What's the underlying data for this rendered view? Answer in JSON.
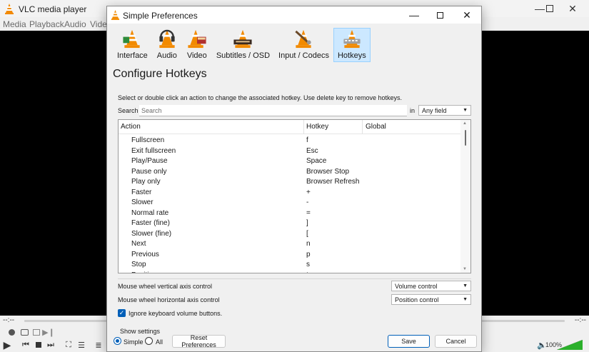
{
  "vlc": {
    "title": "VLC media player",
    "menu": [
      "Media",
      "Playback",
      "Audio",
      "Video"
    ],
    "time_elapsed": "--:--",
    "time_total": "--:--",
    "volume": "100%",
    "volume_level": 1.0
  },
  "dialog": {
    "title": "Simple Preferences",
    "categories": [
      {
        "label": "Interface",
        "icon": "interface-icon"
      },
      {
        "label": "Audio",
        "icon": "audio-icon"
      },
      {
        "label": "Video",
        "icon": "video-icon"
      },
      {
        "label": "Subtitles / OSD",
        "icon": "subtitles-icon"
      },
      {
        "label": "Input / Codecs",
        "icon": "input-codecs-icon"
      },
      {
        "label": "Hotkeys",
        "icon": "hotkeys-icon",
        "active": true
      }
    ],
    "section_title": "Configure Hotkeys",
    "instructions": "Select or double click an action to change the associated hotkey. Use delete key to remove hotkeys.",
    "search": {
      "label": "Search",
      "placeholder": "Search",
      "in_label": "in",
      "field_value": "Any field"
    },
    "table": {
      "headers": [
        "Action",
        "Hotkey",
        "Global"
      ],
      "rows": [
        {
          "action": "Fullscreen",
          "hotkey": "f"
        },
        {
          "action": "Exit fullscreen",
          "hotkey": "Esc"
        },
        {
          "action": "Play/Pause",
          "hotkey": "Space"
        },
        {
          "action": "Pause only",
          "hotkey": "Browser Stop"
        },
        {
          "action": "Play only",
          "hotkey": "Browser Refresh"
        },
        {
          "action": "Faster",
          "hotkey": "+"
        },
        {
          "action": "Slower",
          "hotkey": "-"
        },
        {
          "action": "Normal rate",
          "hotkey": "="
        },
        {
          "action": "Faster (fine)",
          "hotkey": "]"
        },
        {
          "action": "Slower (fine)",
          "hotkey": "["
        },
        {
          "action": "Next",
          "hotkey": "n"
        },
        {
          "action": "Previous",
          "hotkey": "p"
        },
        {
          "action": "Stop",
          "hotkey": "s"
        },
        {
          "action": "Position",
          "hotkey": "t"
        }
      ]
    },
    "mouse_vertical": {
      "label": "Mouse wheel vertical axis control",
      "value": "Volume control"
    },
    "mouse_horizontal": {
      "label": "Mouse wheel horizontal axis control",
      "value": "Position control"
    },
    "ignore_volume": {
      "label": "Ignore keyboard volume buttons.",
      "checked": true
    },
    "show_settings": {
      "label": "Show settings",
      "simple": "Simple",
      "all": "All",
      "selected": "Simple"
    },
    "buttons": {
      "reset": "Reset Preferences",
      "save": "Save",
      "cancel": "Cancel"
    }
  },
  "colors": {
    "accent": "#005fb8",
    "active_tab_bg": "#cce8ff",
    "vlc_orange": "#f28a00",
    "volume_green": "#2bb02b"
  }
}
